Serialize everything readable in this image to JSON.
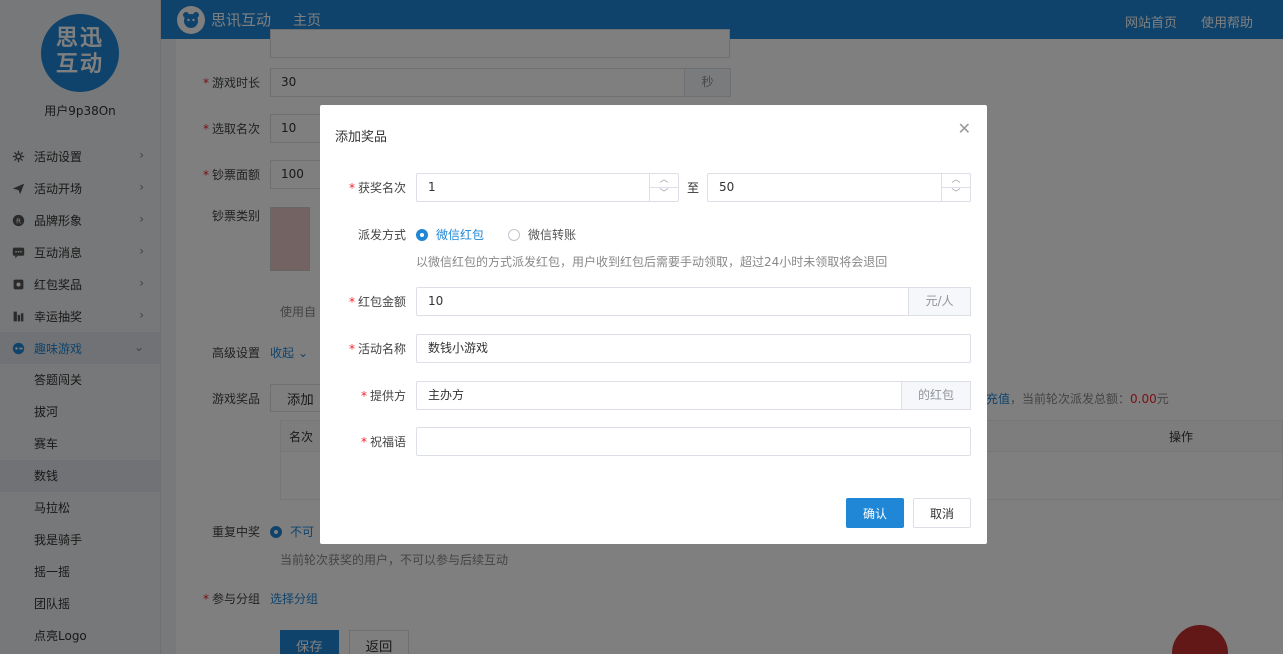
{
  "sidebar": {
    "logo_line1": "思迅",
    "logo_line2": "互动",
    "username": "用户9p38On",
    "items": [
      {
        "label": "活动设置",
        "icon": "gear-icon"
      },
      {
        "label": "活动开场",
        "icon": "paper-plane-icon"
      },
      {
        "label": "品牌形象",
        "icon": "registered-icon"
      },
      {
        "label": "互动消息",
        "icon": "message-icon"
      },
      {
        "label": "红包奖品",
        "icon": "gift-icon"
      },
      {
        "label": "幸运抽奖",
        "icon": "lottery-icon"
      },
      {
        "label": "趣味游戏",
        "icon": "game-icon"
      }
    ],
    "sub_items": [
      "答题闯关",
      "拔河",
      "赛车",
      "数钱",
      "马拉松",
      "我是骑手",
      "摇一摇",
      "团队摇",
      "点亮Logo"
    ]
  },
  "topbar": {
    "brand": "思讯互动",
    "home": "主页",
    "links": [
      "网站首页",
      "使用帮助"
    ]
  },
  "main": {
    "duration_label": "游戏时长",
    "duration_value": "30",
    "duration_unit": "秒",
    "ranks_label": "选取名次",
    "ranks_value": "10",
    "face_label": "钞票面额",
    "face_value": "100",
    "type_label": "钞票类别",
    "type_hint": "使用自",
    "advanced_label": "高级设置",
    "advanced_toggle": "收起",
    "prize_label": "游戏奖品",
    "prize_add_btn": "添加",
    "recharge_link": "充值",
    "dispatch_text": "，当前轮次派发总额：",
    "dispatch_amount": "0.00",
    "dispatch_unit": "元",
    "table_col_rank": "名次",
    "table_col_op": "操作",
    "repeat_label": "重复中奖",
    "repeat_option": "不可",
    "repeat_hint": "当前轮次获奖的用户，不可以参与后续互动",
    "group_label": "参与分组",
    "group_link": "选择分组",
    "save_btn": "保存",
    "back_btn": "返回"
  },
  "dialog": {
    "title": "添加奖品",
    "rank_label": "获奖名次",
    "rank_from": "1",
    "rank_to_sep": "至",
    "rank_to": "50",
    "method_label": "派发方式",
    "method_option1": "微信红包",
    "method_option2": "微信转账",
    "method_hint": "以微信红包的方式派发红包，用户收到红包后需要手动领取，超过24小时未领取将会退回",
    "amount_label": "红包金额",
    "amount_value": "10",
    "amount_unit": "元/人",
    "activity_label": "活动名称",
    "activity_value": "数钱小游戏",
    "provider_label": "提供方",
    "provider_value": "主办方",
    "provider_suffix": "的红包",
    "greeting_label": "祝福语",
    "greeting_value": "",
    "confirm": "确认",
    "cancel": "取消"
  }
}
